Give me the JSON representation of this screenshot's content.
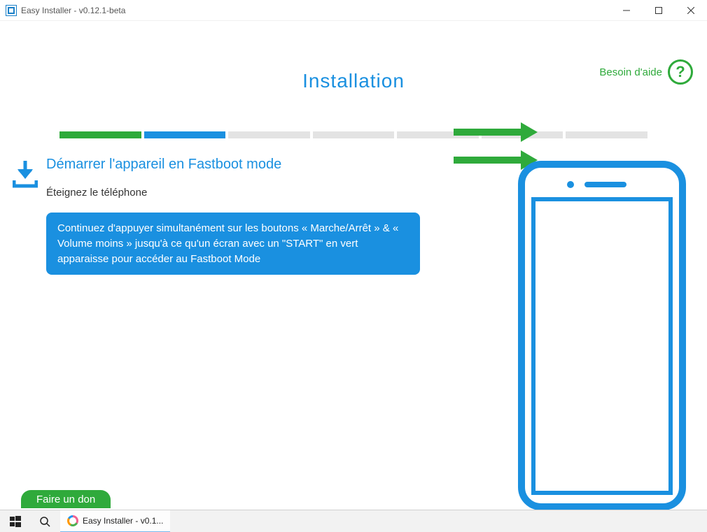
{
  "window": {
    "title": "Easy Installer - v0.12.1-beta"
  },
  "help": {
    "label": "Besoin d'aide"
  },
  "page": {
    "heading": "Installation"
  },
  "progress": {
    "segments": 7,
    "done_segments": 1,
    "current_segment": 2
  },
  "step": {
    "title": "Démarrer l'appareil en Fastboot mode",
    "subtitle": "Éteignez le téléphone",
    "callout": "Continuez d'appuyer simultanément sur les boutons « Marche/Arrêt » & « Volume moins » jusqu'à ce qu'un écran avec un \"START\" en vert apparaisse pour accéder au Fastboot Mode"
  },
  "donate": {
    "label": "Faire un don"
  },
  "taskbar": {
    "app_label": "Easy Installer - v0.1..."
  },
  "colors": {
    "accent_blue": "#1a90e0",
    "accent_green": "#2faa3b"
  }
}
